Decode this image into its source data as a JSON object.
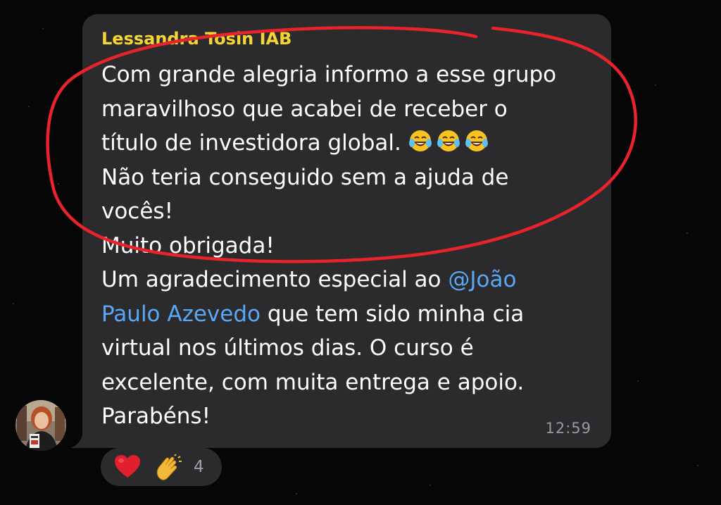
{
  "message": {
    "sender": "Lessandra Tosin IAB",
    "lines": [
      "Com grande alegria informo a esse grupo",
      "maravilhoso que acabei de receber o",
      "título de investidora global.",
      "Não teria conseguido sem a ajuda de",
      "vocês!",
      "Muito obrigada!",
      "Um agradecimento especial ao "
    ],
    "mention_part1": "@João",
    "mention_part2": "Paulo Azevedo",
    "after_mention": " que tem sido minha cia",
    "lines_end": [
      "virtual nos últimos dias. O curso é",
      "excelente, com muita entrega e apoio.",
      "Parabéns!"
    ],
    "inline_emojis": [
      "face-with-tears-of-joy",
      "face-with-tears-of-joy",
      "face-with-tears-of-joy"
    ],
    "time": "12:59"
  },
  "reactions": {
    "items": [
      "red-heart",
      "clapping-hands"
    ],
    "count": "4"
  },
  "colors": {
    "sender": "#f5d533",
    "mention": "#5aa8f5",
    "bubble": "#2b2b2d",
    "annotation_circle": "#e8232b"
  }
}
